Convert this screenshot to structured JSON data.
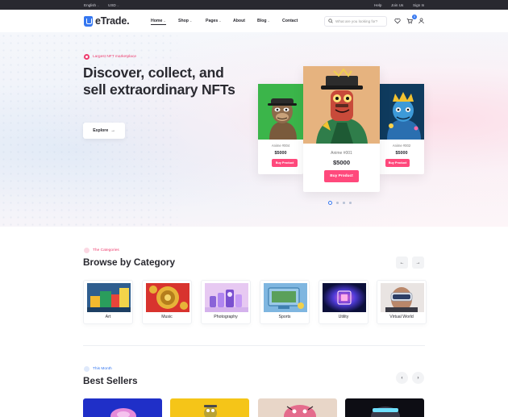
{
  "topbar": {
    "language": "English",
    "currency": "USD",
    "links": [
      "Help",
      "Join Us",
      "Sign In"
    ]
  },
  "header": {
    "logo_text": "eTrade.",
    "nav": [
      "Home",
      "Shop",
      "Pages",
      "About",
      "Blog",
      "Contact"
    ],
    "search_placeholder": "What are you looking for?",
    "cart_count": "0"
  },
  "hero": {
    "tag": "Largest NFT marketplace",
    "title": "Discover, collect, and sell extraordinary NFTs",
    "button_label": "Explore",
    "cards": [
      {
        "name": "Anime #004",
        "price": "$5000",
        "button": "Buy Product"
      },
      {
        "name": "Anime #001",
        "price": "$5000",
        "button": "Buy Product"
      },
      {
        "name": "Anime #002",
        "price": "$5000",
        "button": "Buy Product"
      }
    ],
    "active_slide": 1
  },
  "categories": {
    "tag": "The Categories",
    "title": "Browse by Category",
    "items": [
      "Art",
      "Music",
      "Photography",
      "Sports",
      "Utility",
      "Virtual World"
    ]
  },
  "best_sellers": {
    "tag": "This Month",
    "title": "Best Sellers"
  },
  "colors": {
    "primary": "#3577f0",
    "accent": "#ee3c6e",
    "buy": "#ff497c",
    "dark": "#292930"
  }
}
